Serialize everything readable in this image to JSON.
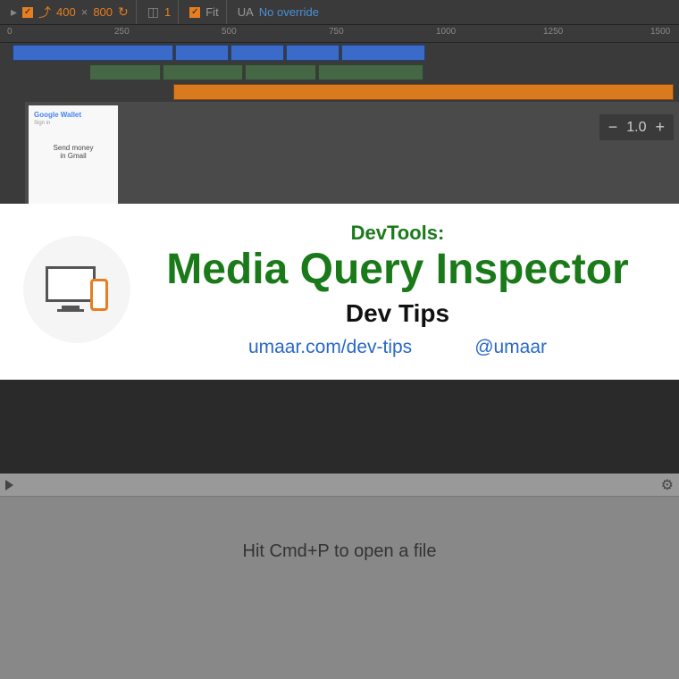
{
  "toolbar": {
    "width": "400",
    "height": "800",
    "scale": "1",
    "fit_label": "Fit",
    "ua_label": "UA",
    "ua_value": "No override"
  },
  "ruler": {
    "ticks": [
      "0",
      "250",
      "500",
      "750",
      "1000",
      "1250",
      "1500"
    ]
  },
  "preview": {
    "logo": "Google Wallet",
    "sub": "Sign in",
    "body1": "Send money",
    "body2": "in Gmail"
  },
  "zoom": {
    "value": "1.0"
  },
  "banner": {
    "eyebrow": "DevTools:",
    "title": "Media Query Inspector",
    "subtitle": "Dev Tips",
    "link1": "umaar.com/dev-tips",
    "link2": "@umaar"
  },
  "lower": {
    "hint": "Hit Cmd+P to open a file"
  }
}
